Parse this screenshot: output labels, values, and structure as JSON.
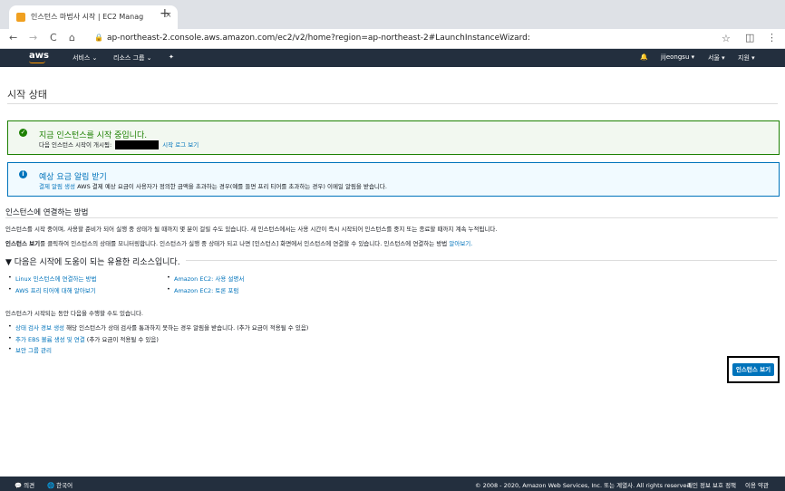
{
  "browser": {
    "tab_title": "인스턴스 마법사 시작 | EC2 Manag",
    "tab_close": "×",
    "new_tab": "+",
    "back": "←",
    "forward": "→",
    "reload": "C",
    "home": "⌂",
    "lock": "🔒",
    "url": "ap-northeast-2.console.aws.amazon.com/ec2/v2/home?region=ap-northeast-2#LaunchInstanceWizard:",
    "star": "☆",
    "ext": "◫",
    "menu": "⋮"
  },
  "nav": {
    "logo": "aws",
    "services": "서비스 ⌄",
    "resource_groups": "리소스 그룹 ⌄",
    "pin": "✦",
    "bell": "🔔",
    "user": "jijeongsu ▾",
    "region": "서울 ▾",
    "support": "지원 ▾"
  },
  "page": {
    "title": "시작 상태"
  },
  "success": {
    "icon": "✓",
    "title": "지금 인스턴스를 시작 중입니다.",
    "line_prefix": "다음 인스턴스 시작이 개시됨:",
    "log_link": "시작 로그 보기"
  },
  "info": {
    "icon": "i",
    "title": "예상 요금 알림 받기",
    "link": "결제 알림 생성",
    "text": " AWS 결제 예상 요금이 사용자가 정의한 금액을 초과하는 경우(예를 들면 프리 티어를 초과하는 경우) 이메일 알림을 받습니다."
  },
  "connect": {
    "heading": "인스턴스에 연결하는 방법",
    "p1": "인스턴스를 시작 중이며, 사용할 준비가 되어 실행 중 상태가 될 때까지 몇 분이 걸릴 수도 있습니다. 새 인스턴스에서는 사용 시간이 즉시 시작되어 인스턴스를 중지 또는 종료할 때까지 계속 누적됩니다.",
    "p2_bold": "인스턴스 보기",
    "p2_text": "를 클릭하여 인스턴스의 상태를 모니터링합니다. 인스턴스가 실행 중 상태가 되고 나면 [인스턴스] 화면에서 인스턴스에 연결할 수 있습니다. 인스턴스에 연결하는 방법 ",
    "p2_link": "알아보기."
  },
  "resources": {
    "heading": "▼ 다음은 시작에 도움이 되는 유용한 리소스입니다.",
    "left": [
      "Linux 인스턴스에 연결하는 방법",
      "AWS 프리 티어에 대해 알아보기"
    ],
    "right": [
      "Amazon EC2: 사용 설명서",
      "Amazon EC2: 토론 포럼"
    ]
  },
  "while": {
    "intro": "인스턴스가 시작되는 동안 다음을 수행할 수도 있습니다.",
    "item1_link": "상태 검사 경보 생성",
    "item1_text": " 해당 인스턴스가 상태 검사를 통과하지 못하는 경우 알림을 받습니다. (추가 요금이 적용될 수 있음)",
    "item2_link": "추가 EBS 볼륨 생성 및 연결",
    "item2_text": " (추가 요금이 적용될 수 있음)",
    "item3_link": "보안 그룹 관리"
  },
  "button": {
    "view_instances": "인스턴스 보기"
  },
  "footer": {
    "feedback": "💬 의견",
    "language": "🌐 한국어",
    "copyright": "© 2008 - 2020, Amazon Web Services, Inc. 또는 계열사. All rights reserved.",
    "privacy": "개인 정보 보호 정책",
    "terms": "이용 약관"
  }
}
